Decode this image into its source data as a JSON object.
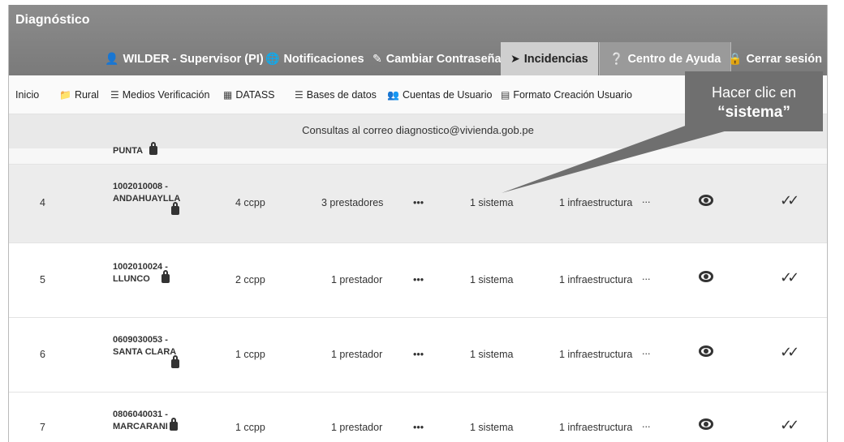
{
  "app": {
    "title": "Diagnóstico"
  },
  "nav": {
    "user": "WILDER - Supervisor (PI)",
    "notifications": "Notificaciones",
    "change_password": "Cambiar Contraseña",
    "incidents": "Incidencias",
    "help": "Centro de Ayuda",
    "logout": "Cerrar sesión"
  },
  "subnav": {
    "home": "Inicio",
    "rural": "Rural",
    "verification": "Medios Verificación",
    "datass": "DATASS",
    "databases": "Bases de datos",
    "accounts": "Cuentas de Usuario",
    "user_form": "Formato Creación Usuario"
  },
  "notice": "Consultas al correo diagnostico@vivienda.gob.pe",
  "partial_row": {
    "name": "PUNTA"
  },
  "rows": [
    {
      "num": "4",
      "code": "1002010008 -",
      "name": "ANDAHUAYLLA",
      "ccpp": "4 ccpp",
      "prestadores": "3 prestadores",
      "dots": "•••",
      "sistema": "1 sistema",
      "infra": "1 infraestructura",
      "more": "...",
      "check": "✓✓"
    },
    {
      "num": "5",
      "code": "1002010024 -",
      "name": "LLUNCO",
      "ccpp": "2 ccpp",
      "prestadores": "1 prestador",
      "dots": "•••",
      "sistema": "1 sistema",
      "infra": "1 infraestructura",
      "more": "...",
      "check": "✓✓"
    },
    {
      "num": "6",
      "code": "0609030053 -",
      "name": "SANTA CLARA",
      "ccpp": "1 ccpp",
      "prestadores": "1 prestador",
      "dots": "•••",
      "sistema": "1 sistema",
      "infra": "1 infraestructura",
      "more": "...",
      "check": "✓✓"
    },
    {
      "num": "7",
      "code": "0806040031 -",
      "name": "MARCARANI",
      "ccpp": "1 ccpp",
      "prestadores": "1 prestador",
      "dots": "•••",
      "sistema": "1 sistema",
      "infra": "1 infraestructura",
      "more": "...",
      "check": "✓✓"
    }
  ],
  "callout": {
    "line1": "Hacer clic en",
    "line2": "“sistema”"
  },
  "icons": {
    "user": "user-icon",
    "notifications": "globe-icon",
    "change_password": "edit-icon",
    "incidents": "paper-plane-icon",
    "help": "question-circle-icon",
    "logout": "lock-icon"
  },
  "colors": {
    "topbar": "#8c8c8c",
    "active_tab": "#cfcfcf",
    "callout": "#6f6f6f"
  }
}
